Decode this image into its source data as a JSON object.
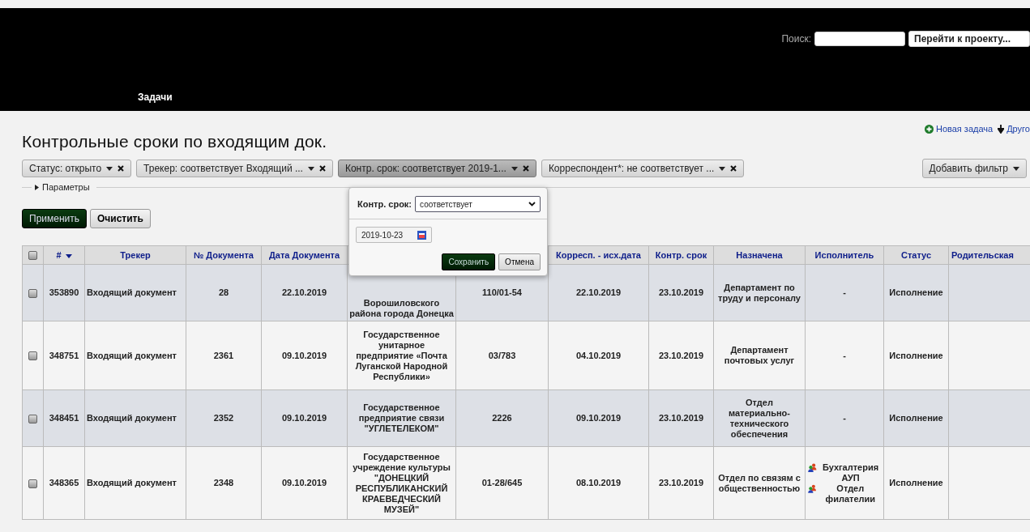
{
  "header": {
    "search_label": "Поиск:",
    "project_jump": "Перейти к проекту...",
    "menu": [
      {
        "label": "Задачи",
        "selected": false
      }
    ]
  },
  "page": {
    "title": "Контрольные сроки по входящим док.",
    "actions": [
      {
        "kind": "new",
        "label": "Новая задача"
      },
      {
        "kind": "download",
        "label": "Друго"
      }
    ]
  },
  "filters": [
    {
      "label": "Статус: открыто",
      "open": false
    },
    {
      "label": "Трекер: соответствует Входящий ...",
      "open": false
    },
    {
      "label": "Контр. срок: соответствует 2019-1...",
      "open": true
    },
    {
      "label": "Корреспондент*: не соответствует ...",
      "open": false
    }
  ],
  "add_filter": "Добавить фильтр",
  "parameters": "Параметры",
  "apply": "Применить",
  "clear": "Очистить",
  "popup": {
    "label": "Контр. срок:",
    "operator": "соответствует",
    "date": "2019-10-23",
    "save": "Сохранить",
    "cancel": "Отмена"
  },
  "table": {
    "all_checked": false,
    "columns": [
      {
        "label": "#",
        "sorted": true
      },
      {
        "label": "Трекер"
      },
      {
        "label": "№ Документа"
      },
      {
        "label": "Дата Документа"
      },
      {
        "covered": true
      },
      {
        "covered": true
      },
      {
        "label": "Корресп. - исх.дата"
      },
      {
        "label": "Контр. срок"
      },
      {
        "label": "Назначена"
      },
      {
        "label": "Исполнитель"
      },
      {
        "label": "Статус"
      },
      {
        "label": "Родительская"
      }
    ],
    "rows": [
      {
        "checked": false,
        "cells": [
          "353890",
          "Входящий документ",
          "28",
          "22.10.2019",
          "Ворошиловского района города Донецка",
          "110/01-54",
          "22.10.2019",
          "23.10.2019",
          "Департамент по труду и персоналу"
        ],
        "executor": {
          "kind": "text",
          "text": "-"
        },
        "status": "Исполнение"
      },
      {
        "checked": false,
        "cells": [
          "348751",
          "Входящий документ",
          "2361",
          "09.10.2019",
          "Государственное унитарное предприятие «Почта Луганской Народной Республики»",
          "03/783",
          "04.10.2019",
          "23.10.2019",
          "Департамент почтовых услуг"
        ],
        "executor": {
          "kind": "text",
          "text": "-"
        },
        "status": "Исполнение"
      },
      {
        "checked": false,
        "cells": [
          "348451",
          "Входящий документ",
          "2352",
          "09.10.2019",
          "Государственное предприятие связи \"УГЛЕТЕЛЕКОМ\"",
          "2226",
          "09.10.2019",
          "23.10.2019",
          "Отдел материально-технического обеспечения"
        ],
        "executor": {
          "kind": "text",
          "text": "-"
        },
        "status": "Исполнение"
      },
      {
        "checked": false,
        "cells": [
          "348365",
          "Входящий документ",
          "2348",
          "09.10.2019",
          "Государственное учреждение культуры \"ДОНЕЦКИЙ РЕСПУБЛИКАНСКИЙ КРАЕВЕДЧЕСКИЙ МУЗЕЙ\"",
          "01-28/645",
          "08.10.2019",
          "23.10.2019",
          "Отдел по связям с общественностью"
        ],
        "executor": {
          "kind": "groups",
          "names": [
            "Бухгалтерия АУП",
            "Отдел филателии"
          ]
        },
        "status": "Исполнение"
      }
    ]
  }
}
